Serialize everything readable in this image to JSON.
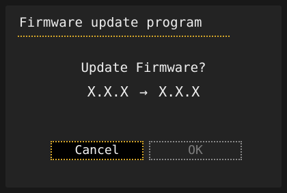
{
  "dialog": {
    "title": "Firmware update program",
    "question": "Update Firmware?",
    "current_version": "X.X.X",
    "arrow_icon": "right-arrow-icon",
    "arrow_glyph": "→",
    "new_version": "X.X.X"
  },
  "buttons": {
    "cancel_label": "Cancel",
    "ok_label": "OK"
  },
  "colors": {
    "accent": "#d6a72a",
    "background": "#232323",
    "disabled_text": "#7d7d7d"
  }
}
